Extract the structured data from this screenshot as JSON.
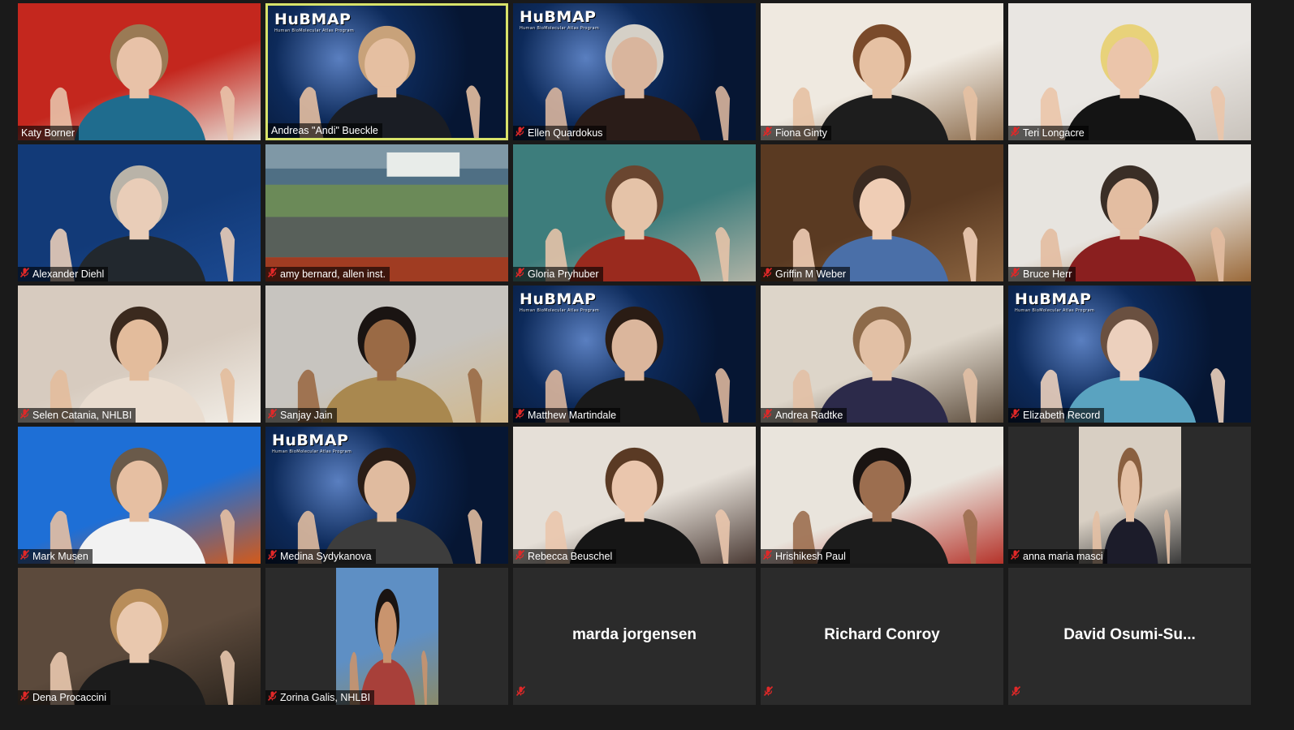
{
  "meeting": {
    "logo_text": "HuBMAP",
    "logo_subtext": "Human BioMolecular Atlas Program"
  },
  "participants": [
    {
      "name": "Katy Borner",
      "muted": false,
      "bg": "#c4271e",
      "bg2": "#e8e1d8",
      "skin": "#e8c2a8",
      "hair": "#9a7a55",
      "shirt": "#1f6c8e",
      "video": true
    },
    {
      "name": "Andreas \"Andi\" Bueckle",
      "muted": false,
      "bg": "#0d2a5a",
      "bg2": "#5a7fc0",
      "skin": "#e5bfa1",
      "hair": "#c8a27a",
      "shirt": "#1a1d24",
      "video": true,
      "hubmap": true,
      "active": true
    },
    {
      "name": "Ellen Quardokus",
      "muted": true,
      "bg": "#0d2a5a",
      "bg2": "#5a7fc0",
      "skin": "#d9b59d",
      "hair": "#d5d0c7",
      "shirt": "#2a1c18",
      "video": true,
      "hubmap": true
    },
    {
      "name": "Fiona Ginty",
      "muted": true,
      "bg": "#efe9e0",
      "bg2": "#8a6a4a",
      "skin": "#e6c1a3",
      "hair": "#7a4a2a",
      "shirt": "#1d1d1d",
      "video": true
    },
    {
      "name": "Teri Longacre",
      "muted": true,
      "bg": "#e9e6e2",
      "bg2": "#c9c3bc",
      "skin": "#ebc5aa",
      "hair": "#e8d27a",
      "shirt": "#141414",
      "video": true
    },
    {
      "name": "Alexander Diehl",
      "muted": true,
      "bg": "#123a78",
      "bg2": "#1c4a92",
      "skin": "#e9cdb8",
      "hair": "#b9b3a8",
      "shirt": "#22282e",
      "video": true
    },
    {
      "name": "amy bernard, allen inst.",
      "muted": true,
      "bg": "#6f8a98",
      "bg2": "#a03c22",
      "skin": "#000000",
      "hair": "#000000",
      "shirt": "#000000",
      "video": true,
      "scene": true
    },
    {
      "name": "Gloria Pryhuber",
      "muted": true,
      "bg": "#3d7d7c",
      "bg2": "#b0b3a6",
      "skin": "#e5c3a8",
      "hair": "#6a4630",
      "shirt": "#9a2a1e",
      "video": true
    },
    {
      "name": "Griffin M Weber",
      "muted": true,
      "bg": "#5a3a22",
      "bg2": "#8b6440",
      "skin": "#efcdb5",
      "hair": "#3a2a20",
      "shirt": "#4a6fa8",
      "video": true
    },
    {
      "name": "Bruce Herr",
      "muted": true,
      "bg": "#e7e4df",
      "bg2": "#9b6a3a",
      "skin": "#e3bda1",
      "hair": "#3a2e26",
      "shirt": "#8a1f1f",
      "video": true
    },
    {
      "name": "Selen Catania, NHLBI",
      "muted": true,
      "bg": "#d7cbbf",
      "bg2": "#f3efe8",
      "skin": "#e3bc9c",
      "hair": "#3b2a1e",
      "shirt": "#e9dccf",
      "video": true
    },
    {
      "name": "Sanjay Jain",
      "muted": true,
      "bg": "#c7c4bf",
      "bg2": "#d1b88c",
      "skin": "#9a6a45",
      "hair": "#1a1412",
      "shirt": "#a9884f",
      "video": true
    },
    {
      "name": "Matthew Martindale",
      "muted": true,
      "bg": "#0d2a5a",
      "bg2": "#5a7fc0",
      "skin": "#dbb69c",
      "hair": "#2a1c14",
      "shirt": "#1a1a1a",
      "video": true,
      "hubmap": true
    },
    {
      "name": "Andrea Radtke",
      "muted": true,
      "bg": "#ddd5c9",
      "bg2": "#5a4a3a",
      "skin": "#e2c0a5",
      "hair": "#8d6a4a",
      "shirt": "#2c2a4a",
      "video": true
    },
    {
      "name": "Elizabeth Record",
      "muted": true,
      "bg": "#0d2a5a",
      "bg2": "#5a7fc0",
      "skin": "#ecd0bd",
      "hair": "#6a5040",
      "shirt": "#5aa3c0",
      "video": true,
      "hubmap": true
    },
    {
      "name": "Mark Musen",
      "muted": true,
      "bg": "#1e6fd6",
      "bg2": "#d35a1a",
      "skin": "#e6bfa2",
      "hair": "#6a5a4a",
      "shirt": "#f2f2f2",
      "video": true
    },
    {
      "name": "Medina Sydykanova",
      "muted": true,
      "bg": "#0d2a5a",
      "bg2": "#5a7fc0",
      "skin": "#e0bb9f",
      "hair": "#2a1d16",
      "shirt": "#3d3d3d",
      "video": true,
      "hubmap": true
    },
    {
      "name": "Rebecca Beuschel",
      "muted": true,
      "bg": "#e5dfd7",
      "bg2": "#4a3a34",
      "skin": "#eac6ad",
      "hair": "#5a3a24",
      "shirt": "#161616",
      "video": true
    },
    {
      "name": "Hrishikesh Paul",
      "muted": true,
      "bg": "#e9e4dc",
      "bg2": "#b5332a",
      "skin": "#9c6e4f",
      "hair": "#1a1412",
      "shirt": "#1c1c1c",
      "video": true
    },
    {
      "name": "anna maria masci",
      "muted": true,
      "bg": "#d8cfc3",
      "bg2": "#3a3a3a",
      "skin": "#e4c0a4",
      "hair": "#8a6040",
      "shirt": "#1c1c2a",
      "video": true,
      "narrow": true
    },
    {
      "name": "Dena Procaccini",
      "muted": true,
      "bg": "#5c4a3c",
      "bg2": "#2a231c",
      "skin": "#e9c8ae",
      "hair": "#b88d5a",
      "shirt": "#1c1c1c",
      "video": true
    },
    {
      "name": "Zorina Galis, NHLBI",
      "muted": true,
      "bg": "#5e8fc4",
      "bg2": "#8a8a6a",
      "skin": "#c9946e",
      "hair": "#1a1412",
      "shirt": "#a8403a",
      "video": true,
      "narrow": true
    },
    {
      "name": "marda jorgensen",
      "display_name": "marda jorgensen",
      "muted": true,
      "video": false
    },
    {
      "name": "Richard Conroy",
      "display_name": "Richard Conroy",
      "muted": true,
      "video": false
    },
    {
      "name": "David  Osumi-Su...",
      "display_name": "David  Osumi-Su...",
      "muted": true,
      "video": false
    }
  ],
  "colors": {
    "background": "#1a1a1a",
    "tile_off": "#2b2b2b",
    "active_speaker_border": "#d8e36a",
    "muted_icon": "#e02828"
  }
}
